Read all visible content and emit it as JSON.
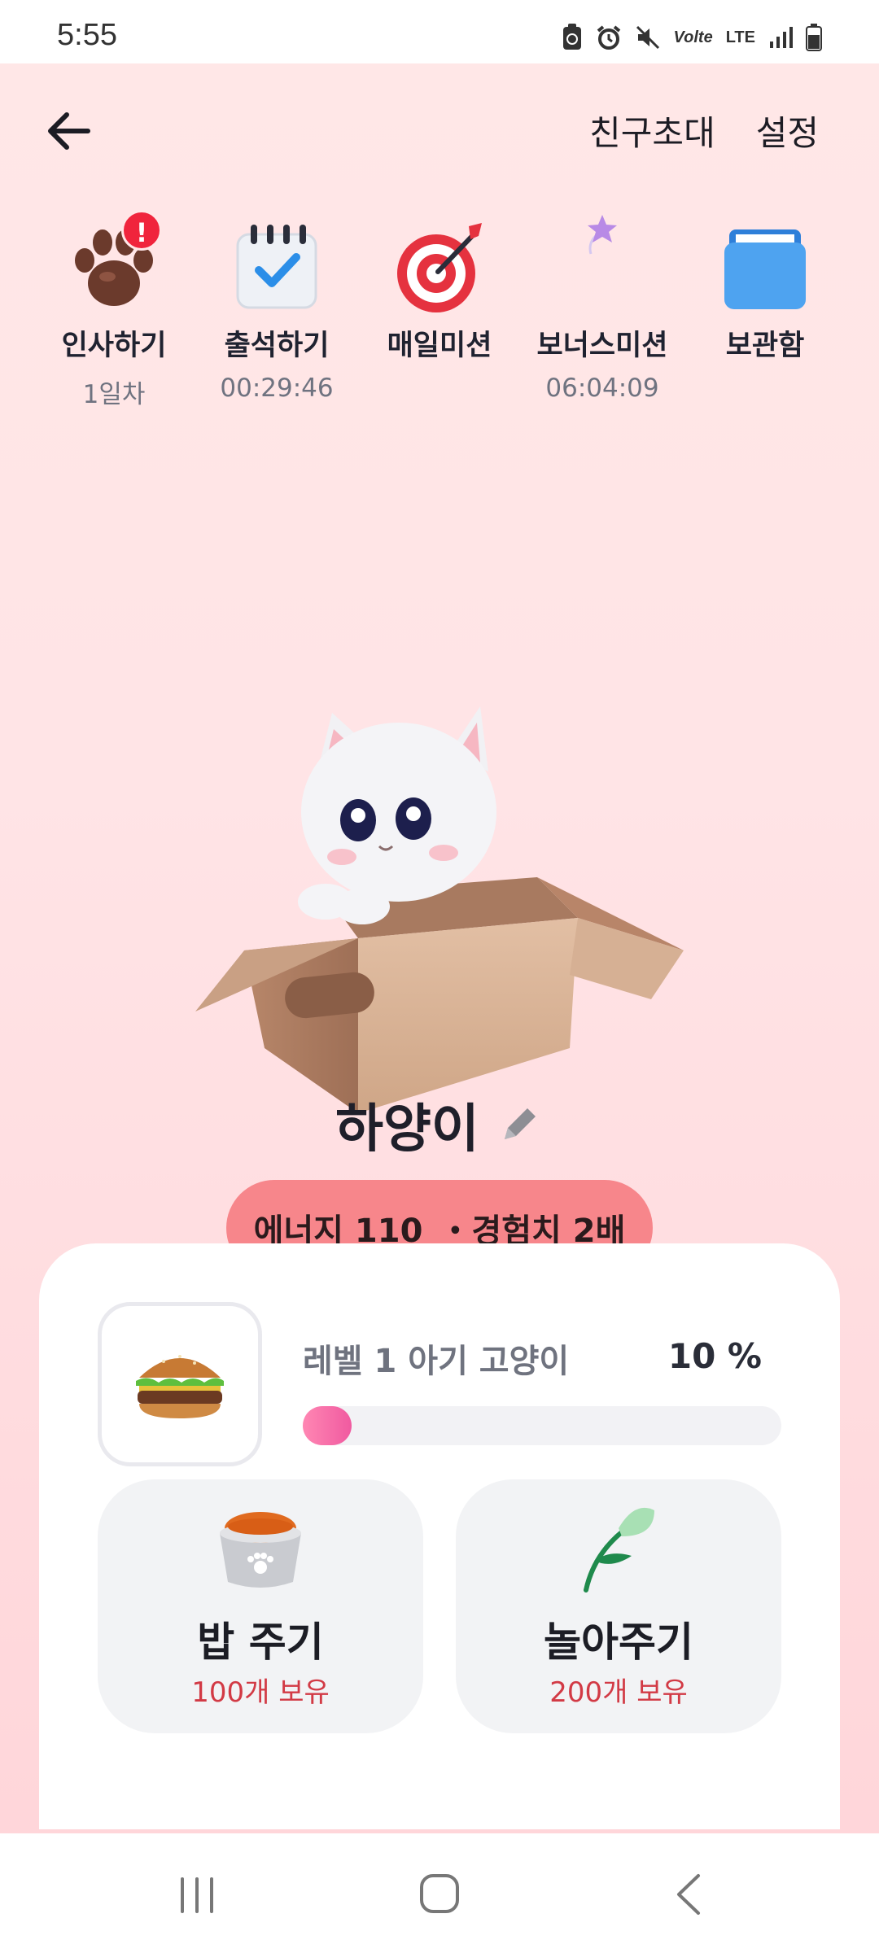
{
  "status_bar": {
    "time": "5:55",
    "network": "LTE"
  },
  "header": {
    "invite": "친구초대",
    "settings": "설정"
  },
  "quick_menu": [
    {
      "label": "인사하기",
      "sub": "1일차",
      "icon": "paw-icon",
      "badge": "!"
    },
    {
      "label": "출석하기",
      "sub": "00:29:46",
      "icon": "calendar-check-icon"
    },
    {
      "label": "매일미션",
      "sub": "",
      "icon": "target-dart-icon"
    },
    {
      "label": "보너스미션",
      "sub": "06:04:09",
      "icon": "star-wand-icon"
    },
    {
      "label": "보관함",
      "sub": "",
      "icon": "folder-box-icon"
    }
  ],
  "pet": {
    "name": "하양이",
    "energy": "에너지 110",
    "exp_bonus": "・경험치 2배"
  },
  "level": {
    "label": "레벨 1 아기 고양이",
    "percent_text": "10 %",
    "progress": 0.1
  },
  "actions": {
    "feed_label": "밥 주기",
    "feed_count": "100개 보유",
    "play_label": "놀아주기",
    "play_count": "200개 보유"
  },
  "colors": {
    "accent_pink": "#f7868b",
    "count_red": "#d23a45",
    "progress": "#f05aa0"
  }
}
